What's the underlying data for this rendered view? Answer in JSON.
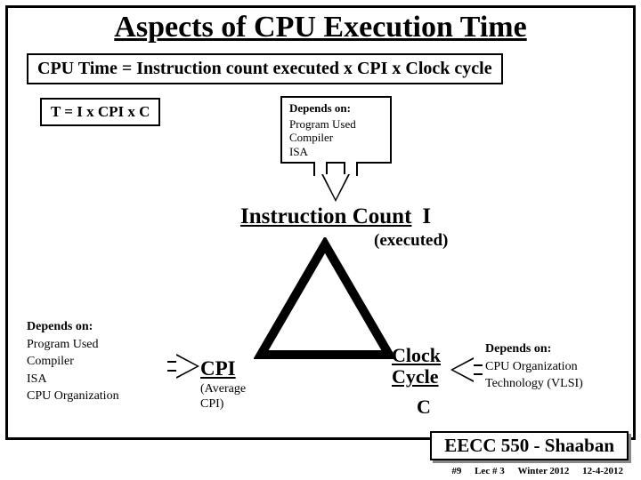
{
  "title": "Aspects of CPU Execution Time",
  "formula_long": "CPU Time = Instruction count executed x CPI x Clock cycle",
  "formula_short": "T = I x CPI x C",
  "depends_top": {
    "heading": "Depends on:",
    "l1": "Program Used",
    "l2": "Compiler",
    "l3": "ISA"
  },
  "instruction_count": "Instruction Count",
  "instruction_I": "I",
  "executed": "(executed)",
  "cpi": "CPI",
  "cpi_sub1": "(Average",
  "cpi_sub2": "CPI)",
  "clock1": "Clock",
  "clock2": "Cycle",
  "clock3": "C",
  "depends_left": {
    "heading": "Depends on:",
    "l1": "Program Used",
    "l2": "Compiler",
    "l3": "ISA",
    "l4": "CPU Organization"
  },
  "depends_right": {
    "heading": "Depends on:",
    "l1": "CPU Organization",
    "l2": "Technology (VLSI)"
  },
  "footer": "EECC 550 - Shaaban",
  "meta1": "#9",
  "meta2": "Lec # 3",
  "meta3": "Winter 2012",
  "meta4": "12-4-2012"
}
